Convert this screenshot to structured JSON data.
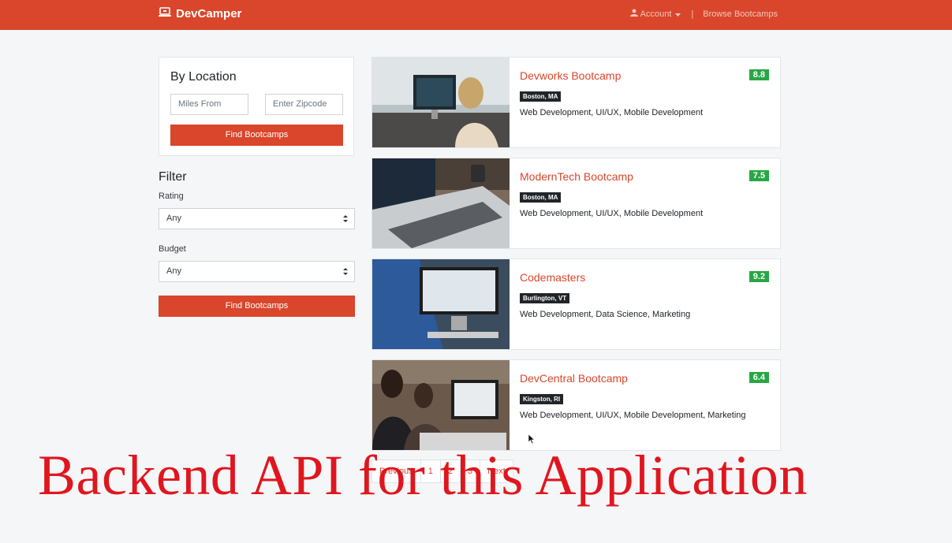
{
  "navbar": {
    "brand": "DevCamper",
    "account_label": "Account",
    "separator": "|",
    "browse_label": "Browse Bootcamps",
    "colors": {
      "bg": "#d9462b",
      "text": "#ffffff"
    }
  },
  "location": {
    "title": "By Location",
    "miles_placeholder": "Miles From",
    "zipcode_placeholder": "Enter Zipcode",
    "button": "Find Bootcamps"
  },
  "filter": {
    "title": "Filter",
    "rating_label": "Rating",
    "rating_value": "Any",
    "budget_label": "Budget",
    "budget_value": "Any",
    "button": "Find Bootcamps"
  },
  "bootcamps": [
    {
      "name": "Devworks Bootcamp",
      "rating": "8.8",
      "location": "Boston, MA",
      "careers": "Web Development, UI/UX, Mobile Development"
    },
    {
      "name": "ModernTech Bootcamp",
      "rating": "7.5",
      "location": "Boston, MA",
      "careers": "Web Development, UI/UX, Mobile Development"
    },
    {
      "name": "Codemasters",
      "rating": "9.2",
      "location": "Burlington, VT",
      "careers": "Web Development, Data Science, Marketing"
    },
    {
      "name": "DevCentral Bootcamp",
      "rating": "6.4",
      "location": "Kingston, RI",
      "careers": "Web Development, UI/UX, Mobile Development, Marketing"
    }
  ],
  "pagination": {
    "previous": "Previous",
    "pages": [
      "1",
      "2",
      "3"
    ],
    "next": "Next"
  },
  "overlay": {
    "text": "Backend API for this Application",
    "color": "#e0161f"
  },
  "icons": [
    "laptop-icon",
    "user-icon",
    "caret-down-icon",
    "select-arrows-icon",
    "mouse-cursor-icon"
  ]
}
